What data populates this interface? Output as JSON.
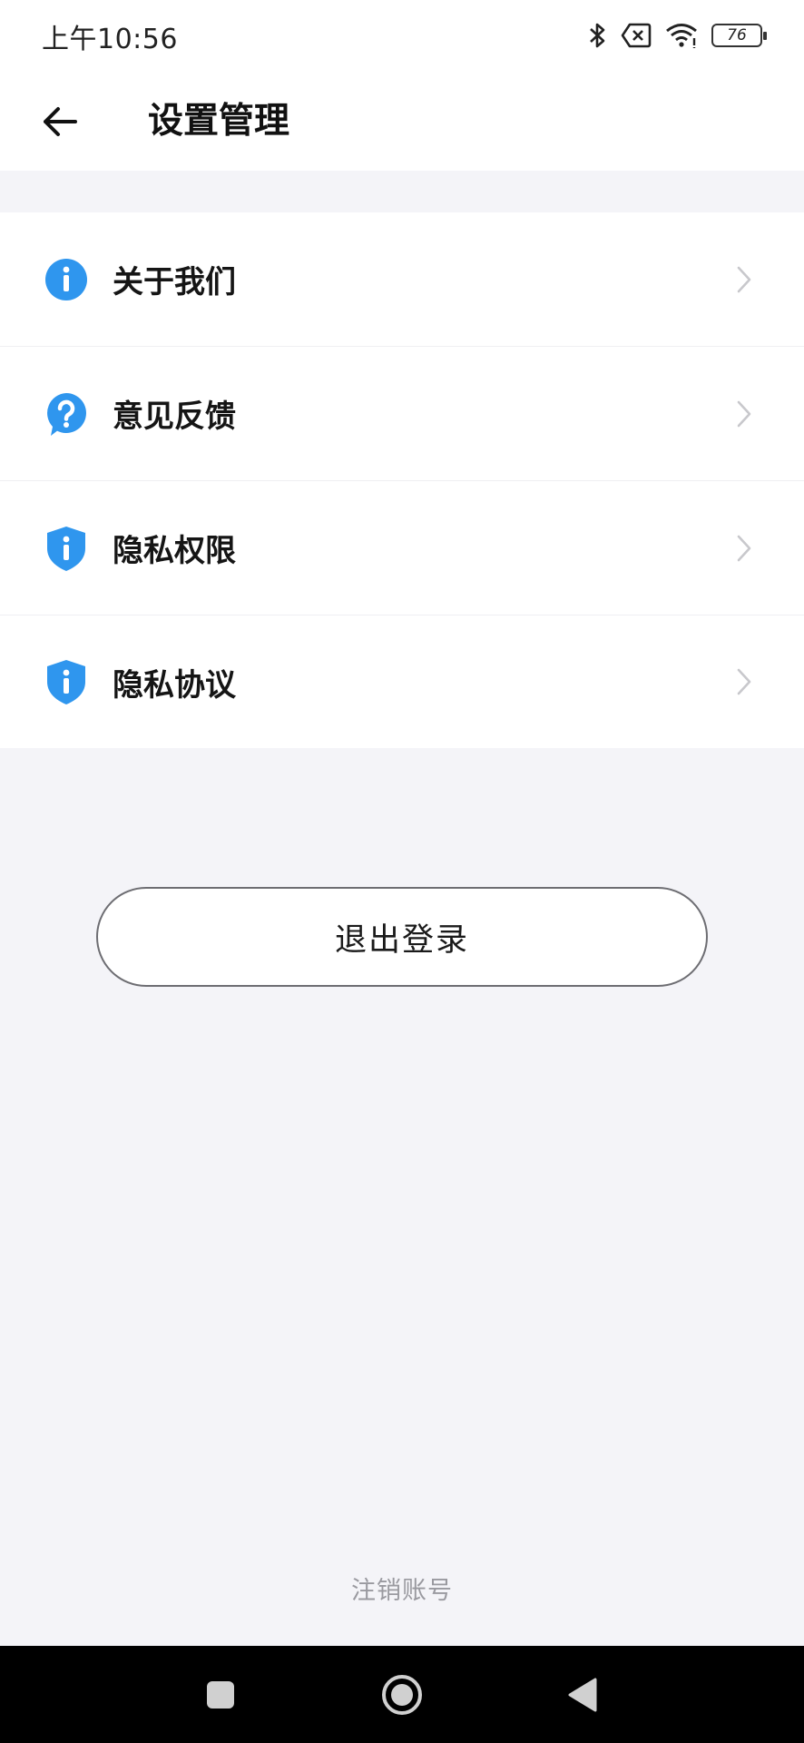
{
  "status_bar": {
    "time": "上午10:56",
    "battery_level": "76",
    "icons": [
      "bluetooth-icon",
      "no-sim-icon",
      "wifi-icon",
      "battery-icon"
    ]
  },
  "header": {
    "back_icon": "arrow-left-icon",
    "title": "设置管理"
  },
  "menu": {
    "items": [
      {
        "label": "关于我们",
        "icon": "info-circle-icon"
      },
      {
        "label": "意见反馈",
        "icon": "question-bubble-icon"
      },
      {
        "label": "隐私权限",
        "icon": "shield-info-icon"
      },
      {
        "label": "隐私协议",
        "icon": "shield-info-icon"
      }
    ]
  },
  "actions": {
    "logout_label": "退出登录",
    "delete_account_label": "注销账号"
  },
  "nav_bar": {
    "buttons": [
      "recents-square-icon",
      "home-circle-icon",
      "back-triangle-icon"
    ]
  },
  "colors": {
    "accent": "#2f96ee",
    "background": "#f4f4f8",
    "surface": "#ffffff",
    "muted_text": "#9a9aa0"
  }
}
